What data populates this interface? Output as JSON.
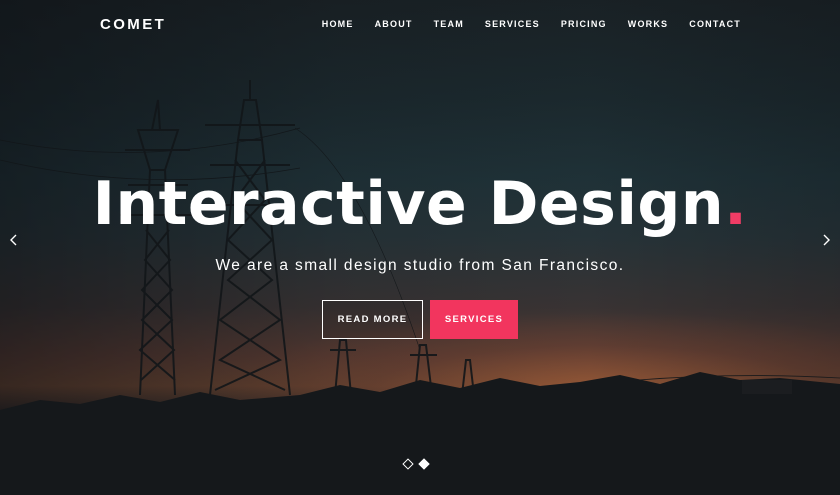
{
  "header": {
    "brand": "COMET",
    "nav": [
      {
        "label": "HOME"
      },
      {
        "label": "ABOUT"
      },
      {
        "label": "TEAM"
      },
      {
        "label": "SERVICES"
      },
      {
        "label": "PRICING"
      },
      {
        "label": "WORKS"
      },
      {
        "label": "CONTACT"
      }
    ]
  },
  "hero": {
    "headline": "Interactive Design",
    "headline_dot": ".",
    "tagline": "We are a small design studio from San Francisco.",
    "primary_button": "READ MORE",
    "secondary_button": "SERVICES",
    "active_slide": 2,
    "slide_count": 2
  },
  "colors": {
    "accent": "#f2355e",
    "text": "#ffffff"
  },
  "icons": {
    "prev": "chevron-left-icon",
    "next": "chevron-right-icon"
  }
}
